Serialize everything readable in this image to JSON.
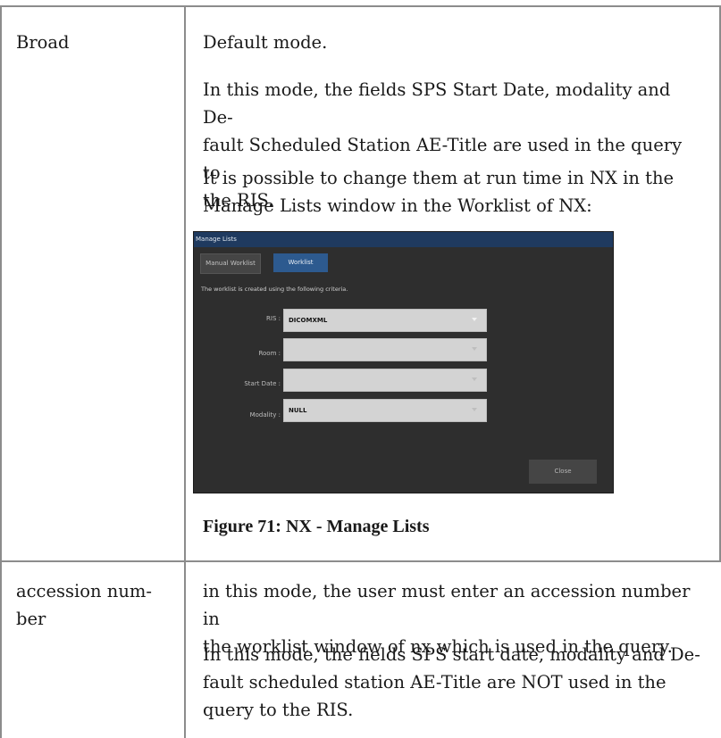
{
  "rows": [
    {
      "term": "Broad",
      "paragraphs": [
        "Default mode.",
        [
          "In this mode, the fields SPS Start Date, modality and De-",
          "fault Scheduled Station AE-Title are used in the query to",
          "the RIS."
        ],
        [
          "It is possible to change them at run time in NX in the",
          "Manage Lists window in the Worklist of NX:"
        ]
      ],
      "figure_caption": "Figure 71: NX - Manage Lists"
    },
    {
      "term": [
        "accession num-",
        "ber"
      ],
      "paragraphs": [
        [
          "in this mode, the user must enter an accession number in",
          "the worklist window of nx which is used in the query."
        ],
        [
          "In this mode, the fields SPS start date, modality and De-",
          "fault scheduled station AE-Title are NOT used in the",
          "query to the RIS."
        ]
      ]
    }
  ],
  "nx_window": {
    "title": "Manage Lists",
    "tabs": [
      "Manual Worklist",
      "Worklist"
    ],
    "active_tab": "Worklist",
    "info": "The worklist is created using the following criteria.",
    "fields": [
      {
        "label": "RIS :",
        "value": "DICOMXML"
      },
      {
        "label": "Room :",
        "value": ""
      },
      {
        "label": "Start Date :",
        "value": ""
      },
      {
        "label": "Modality :",
        "value": "NULL"
      }
    ],
    "close_label": "Close",
    "title_color": "#1f3a5f",
    "active_tab_color": "#2d5a8f"
  }
}
